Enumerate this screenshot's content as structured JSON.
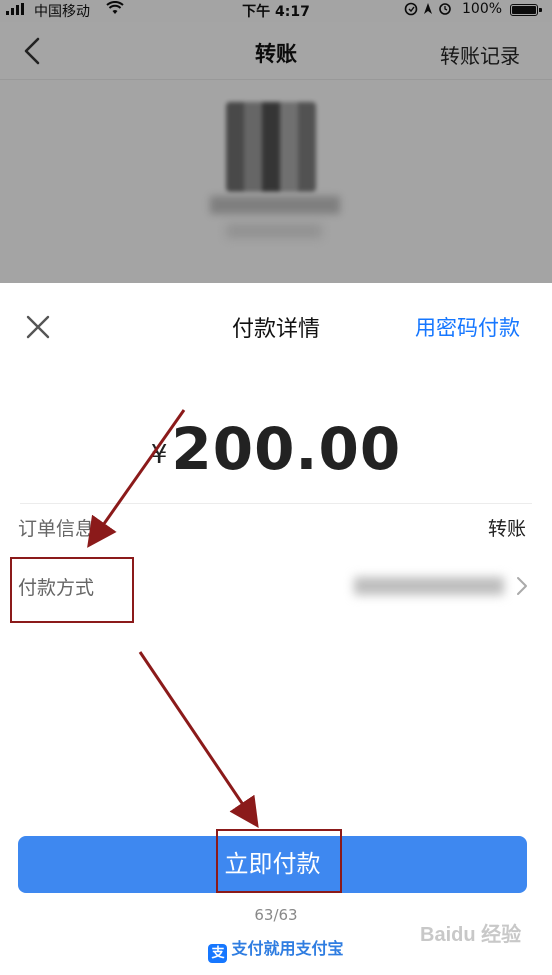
{
  "status_bar": {
    "carrier": "中国移动",
    "time": "下午 4:17",
    "battery": "100%"
  },
  "nav": {
    "title": "转账",
    "history_link": "转账记录",
    "back_icon": "chevron-left-icon"
  },
  "sheet": {
    "title": "付款详情",
    "close_icon": "close-icon",
    "password_link": "用密码付款",
    "amount_symbol": "¥",
    "amount": "200.00",
    "order_info": {
      "label": "订单信息",
      "value": "转账"
    },
    "payment_method": {
      "label": "付款方式",
      "chevron_icon": "chevron-right-icon"
    },
    "pay_button": "立即付款",
    "counter": "63/63",
    "footer_brand": "支付就用支付宝",
    "footer_logo_icon": "alipay-logo-icon"
  },
  "annotations": {
    "color": "#8b1a1a",
    "boxes": [
      "payment-method-row",
      "pay-button"
    ],
    "arrows": 2
  },
  "watermark": "Baidu 经验",
  "colors": {
    "accent_blue": "#1677ff",
    "button_blue": "#3e88f0",
    "annotation_red": "#8b1a1a"
  }
}
